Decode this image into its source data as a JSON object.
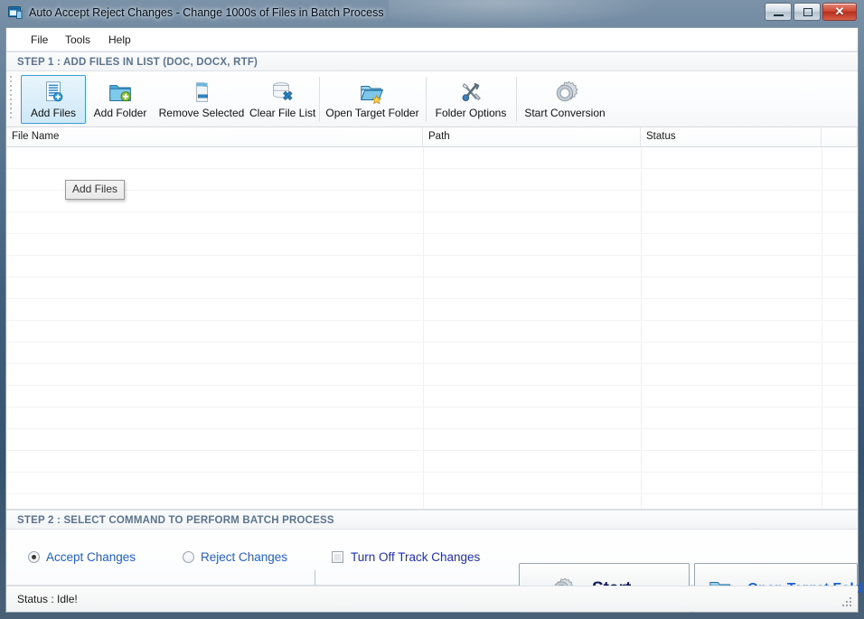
{
  "window": {
    "title": "Auto Accept Reject Changes - Change 1000s of Files in Batch Process",
    "icon": "app-window-icon",
    "controls": {
      "minimize": "–",
      "maximize": "□",
      "close": "✕"
    }
  },
  "menu": {
    "items": [
      {
        "label": "File"
      },
      {
        "label": "Tools"
      },
      {
        "label": "Help"
      }
    ]
  },
  "step1": {
    "header": "STEP 1 : ADD FILES IN LIST (DOC, DOCX, RTF)",
    "toolbar": [
      {
        "label": "Add Files",
        "icon": "document-add-icon",
        "state": "hover"
      },
      {
        "label": "Add Folder",
        "icon": "folder-add-icon",
        "state": "normal"
      },
      {
        "label": "Remove Selected",
        "icon": "document-remove-icon",
        "state": "normal"
      },
      {
        "label": "Clear File List",
        "icon": "database-delete-icon",
        "state": "normal"
      },
      {
        "label": "Open Target Folder",
        "icon": "open-folder-icon",
        "state": "normal"
      },
      {
        "label": "Folder Options",
        "icon": "tools-wrench-icon",
        "state": "normal"
      },
      {
        "label": "Start Conversion",
        "icon": "gear-icon",
        "state": "normal"
      }
    ]
  },
  "tooltip": {
    "text": "Add Files"
  },
  "file_list": {
    "columns": [
      {
        "label": "File Name"
      },
      {
        "label": "Path"
      },
      {
        "label": "Status"
      },
      {
        "label": ""
      }
    ],
    "rows": []
  },
  "step2": {
    "header": "STEP 2 : SELECT COMMAND TO PERFORM BATCH PROCESS",
    "options": [
      {
        "label": "Accept Changes",
        "selected": true
      },
      {
        "label": "Reject Changes",
        "selected": false
      }
    ],
    "checkbox": {
      "label": "Turn Off Track Changes",
      "checked": false
    },
    "buttons": [
      {
        "label": "Start",
        "icon": "gear-icon"
      },
      {
        "label": "Open Target Folder",
        "icon": "open-folder-icon"
      }
    ]
  },
  "statusbar": {
    "text": "Status :  Idle!"
  },
  "colors": {
    "accent_blue": "#1f5fd0",
    "header_blue_gray": "#5a7490",
    "hover_fill": "#cfe9f7",
    "hover_border": "#3c9ad4",
    "start_navy": "#111a5e",
    "close_red": "#cf4a36"
  }
}
